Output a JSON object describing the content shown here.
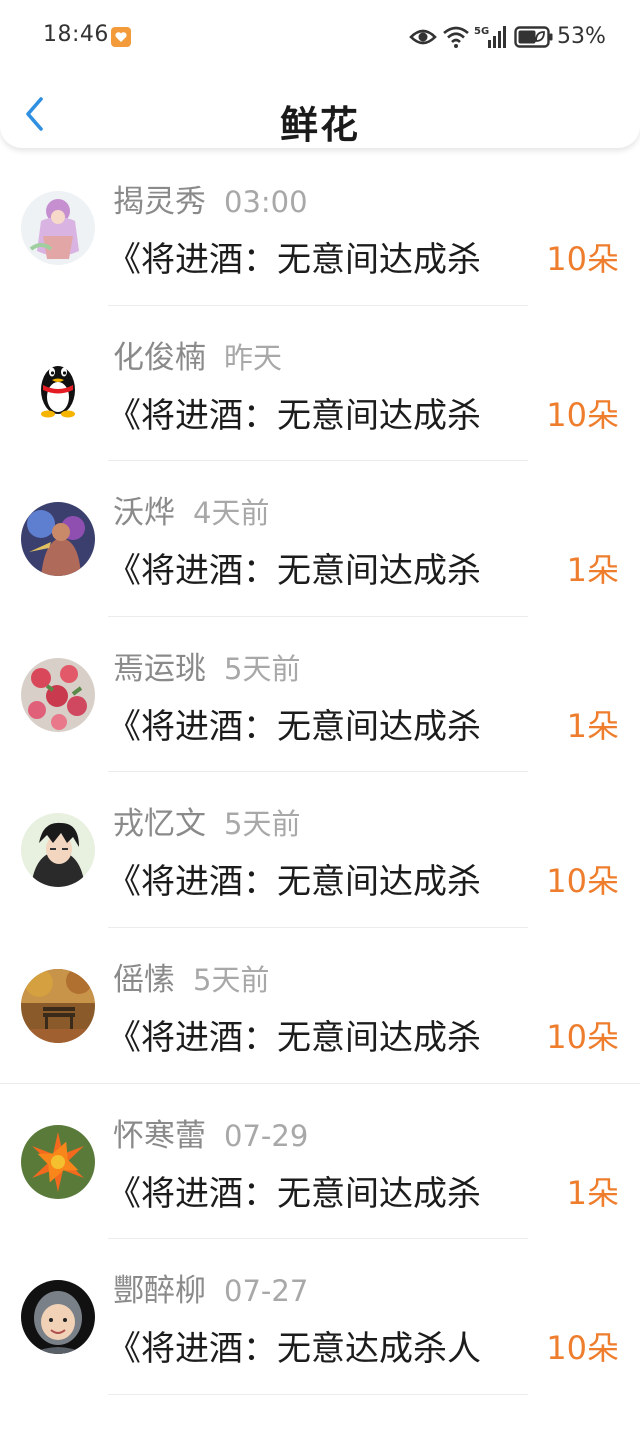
{
  "status_bar": {
    "time": "18:46",
    "battery": "53%",
    "icons": [
      "app-notification-icon",
      "eye-icon",
      "wifi-icon",
      "5g-signal-icon",
      "battery-icon"
    ]
  },
  "header": {
    "title": "鲜花",
    "back_icon": "chevron-left-icon"
  },
  "colors": {
    "accent_blue": "#2f8fe0",
    "count_orange": "#ee7e2e",
    "name_gray": "#8a8a8a"
  },
  "items": [
    {
      "name": "揭灵秀",
      "time": "03:00",
      "message": "《将进酒：无意间达成杀",
      "count": "10朵"
    },
    {
      "name": "化俊楠",
      "time": "昨天",
      "message": "《将进酒：无意间达成杀",
      "count": "10朵"
    },
    {
      "name": "沃烨",
      "time": "4天前",
      "message": "《将进酒：无意间达成杀",
      "count": "1朵"
    },
    {
      "name": "焉运珧",
      "time": "5天前",
      "message": "《将进酒：无意间达成杀",
      "count": "1朵"
    },
    {
      "name": "戎忆文",
      "time": "5天前",
      "message": "《将进酒：无意间达成杀",
      "count": "10朵"
    },
    {
      "name": "傜愫",
      "time": "5天前",
      "message": "《将进酒：无意间达成杀",
      "count": "10朵"
    },
    {
      "name": "怀寒蕾",
      "time": "07-29",
      "message": "《将进酒：无意间达成杀",
      "count": "1朵"
    },
    {
      "name": "酆醉柳",
      "time": "07-27",
      "message": "《将进酒：无意达成杀人",
      "count": "10朵"
    }
  ]
}
